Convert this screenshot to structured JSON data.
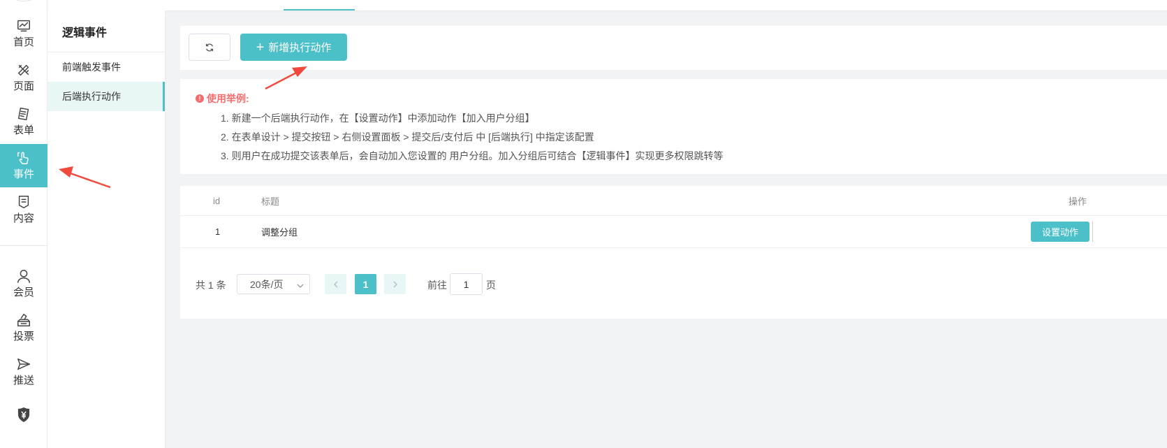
{
  "nav": {
    "items": [
      {
        "label": "首页",
        "icon": "dashboard-icon"
      },
      {
        "label": "页面",
        "icon": "pencil-ruler-icon"
      },
      {
        "label": "表单",
        "icon": "form-icon"
      },
      {
        "label": "事件",
        "icon": "event-hand-icon"
      },
      {
        "label": "内容",
        "icon": "content-icon"
      },
      {
        "label": "会员",
        "icon": "user-icon"
      },
      {
        "label": "投票",
        "icon": "vote-box-icon"
      },
      {
        "label": "推送",
        "icon": "send-icon"
      },
      {
        "label": "",
        "icon": "yen-icon"
      }
    ],
    "active_label": "事件"
  },
  "subside": {
    "title": "逻辑事件",
    "items": [
      {
        "label": "前端触发事件"
      },
      {
        "label": "后端执行动作"
      }
    ],
    "active_label": "后端执行动作"
  },
  "toolbar": {
    "refresh_icon": "refresh-icon",
    "add_label": "新增执行动作",
    "add_icon": "plus-icon"
  },
  "tips": {
    "title": "使用举例:",
    "lines": [
      "1. 新建一个后端执行动作，在【设置动作】中添加动作【加入用户分组】",
      "2. 在表单设计 > 提交按钮 > 右侧设置面板 > 提交后/支付后 中 [后端执行] 中指定该配置",
      "3. 则用户在成功提交该表单后，会自动加入您设置的 用户分组。加入分组后可结合【逻辑事件】实现更多权限跳转等"
    ]
  },
  "table": {
    "columns": [
      "id",
      "标题",
      "操作"
    ],
    "rows": [
      {
        "id": "1",
        "title": "调整分组",
        "action_label": "设置动作"
      }
    ]
  },
  "pagination": {
    "total_text": "共 1 条",
    "page_size": "20条/页",
    "current_page": "1",
    "goto_prefix": "前往",
    "goto_value": "1",
    "goto_suffix": "页"
  },
  "colors": {
    "accent": "#4bc0c8",
    "warning": "#f56c6c",
    "annotation_arrow": "#f04a3e"
  }
}
